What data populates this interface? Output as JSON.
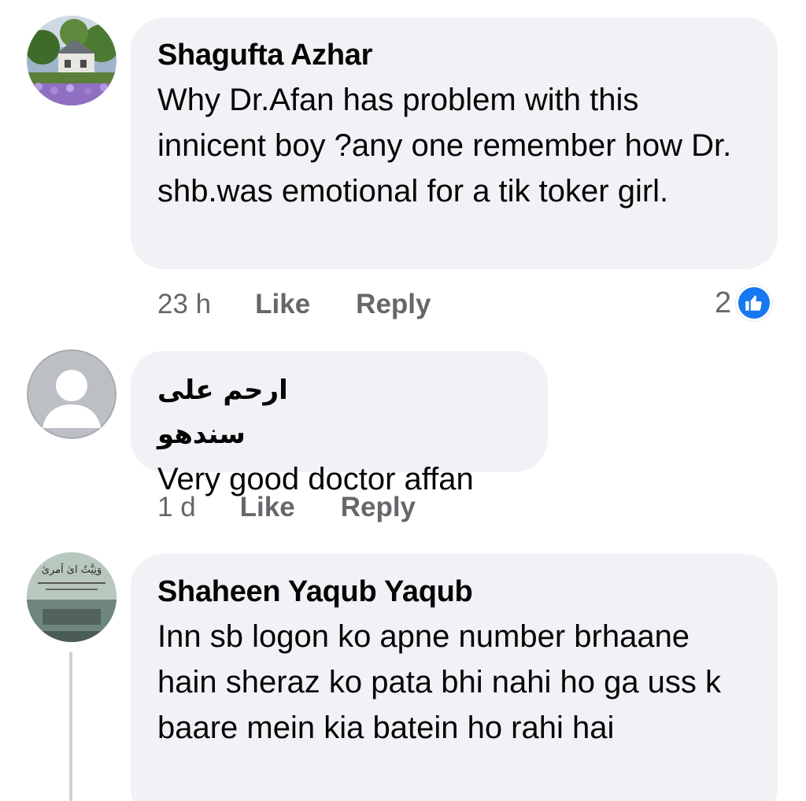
{
  "comments": [
    {
      "author": "Shagufta Azhar",
      "text": "Why Dr.Afan has problem with this innicent boy ?any one remember how Dr. shb.was emotional for a tik toker girl.",
      "time": "23 h",
      "like_label": "Like",
      "reply_label": "Reply",
      "reaction_count": "2",
      "reaction_icon": "like-icon"
    },
    {
      "author": "ارحم علی سندھو",
      "text": "Very good doctor affan",
      "time": "1 d",
      "like_label": "Like",
      "reply_label": "Reply"
    },
    {
      "author": "Shaheen Yaqub Yaqub",
      "text": "Inn sb logon ko apne number brhaane hain sheraz ko pata bhi nahi ho ga uss k baare mein kia batein ho rahi hai",
      "avatar_text": "وَنِیَّتُ ایٰ اَمریٰ"
    }
  ],
  "colors": {
    "bubble": "#f0f2f5",
    "meta_text": "#65676b",
    "like_blue": "#1877f2"
  }
}
